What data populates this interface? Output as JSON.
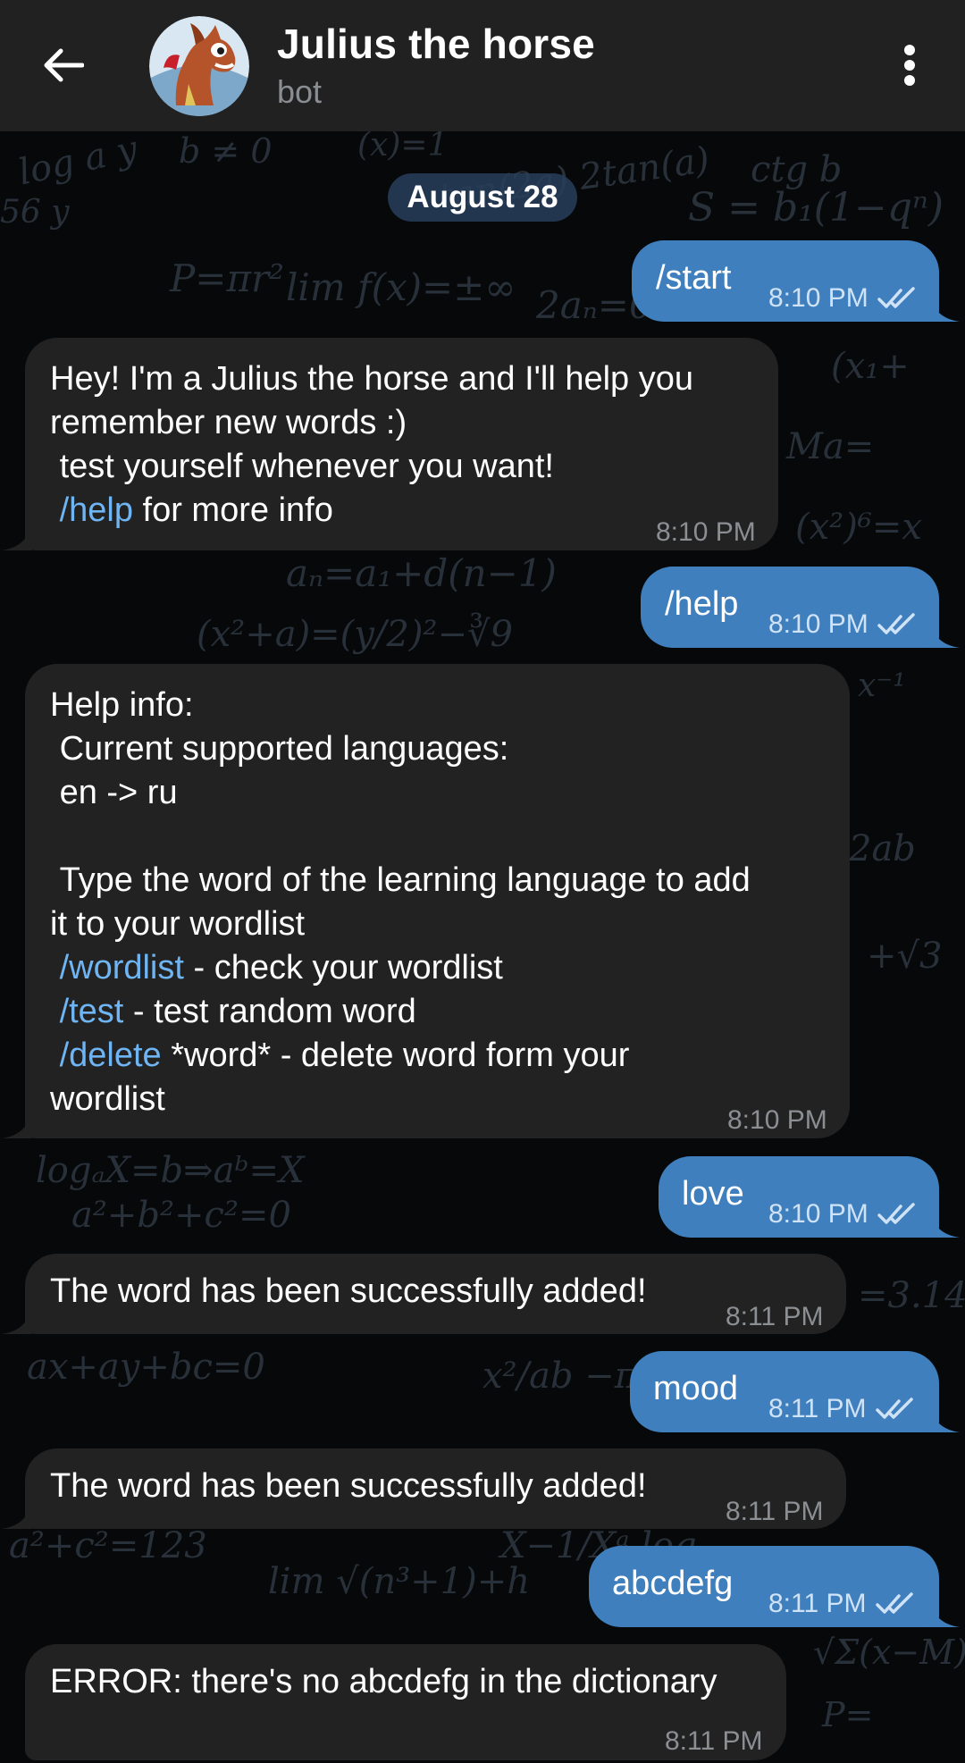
{
  "header": {
    "title": "Julius the horse",
    "subtitle": "bot",
    "back_icon": "arrow-left-icon",
    "menu_icon": "more-vertical-icon"
  },
  "date_separator": "August 28",
  "messages": [
    {
      "dir": "out",
      "text": "/start",
      "time": "8:10 PM",
      "status": "read"
    },
    {
      "dir": "in",
      "lines": [
        "Hey! I'm a Julius the horse and I'll help you",
        "remember new words :)",
        " test yourself whenever you want!",
        " /help for more info"
      ],
      "time": "8:10 PM"
    },
    {
      "dir": "out",
      "text": "/help",
      "time": "8:10 PM",
      "status": "read"
    },
    {
      "dir": "in",
      "lines": [
        "Help info:",
        " Current supported languages:",
        " en -> ru",
        "",
        " Type the word of the learning language to add",
        "it to your wordlist",
        " /wordlist - check your wordlist",
        " /test - test random word",
        " /delete *word* - delete word form your",
        "wordlist"
      ],
      "time": "8:10 PM"
    },
    {
      "dir": "out",
      "text": "love",
      "time": "8:10 PM",
      "status": "read"
    },
    {
      "dir": "in",
      "text": "The word has been successfully added!",
      "time": "8:11 PM"
    },
    {
      "dir": "out",
      "text": "mood",
      "time": "8:11 PM",
      "status": "read"
    },
    {
      "dir": "in",
      "text": "The word has been successfully added!",
      "time": "8:11 PM"
    },
    {
      "dir": "out",
      "text": "abcdefg",
      "time": "8:11 PM",
      "status": "read"
    },
    {
      "dir": "in",
      "text": "ERROR: there's no abcdefg in the dictionary",
      "time": "8:11 PM"
    }
  ],
  "colors": {
    "header_bg": "#212121",
    "outgoing_bubble": "#3f7fbd",
    "incoming_bubble": "#222222",
    "command_link": "#6fb4f3",
    "date_pill": "#283e5c"
  }
}
